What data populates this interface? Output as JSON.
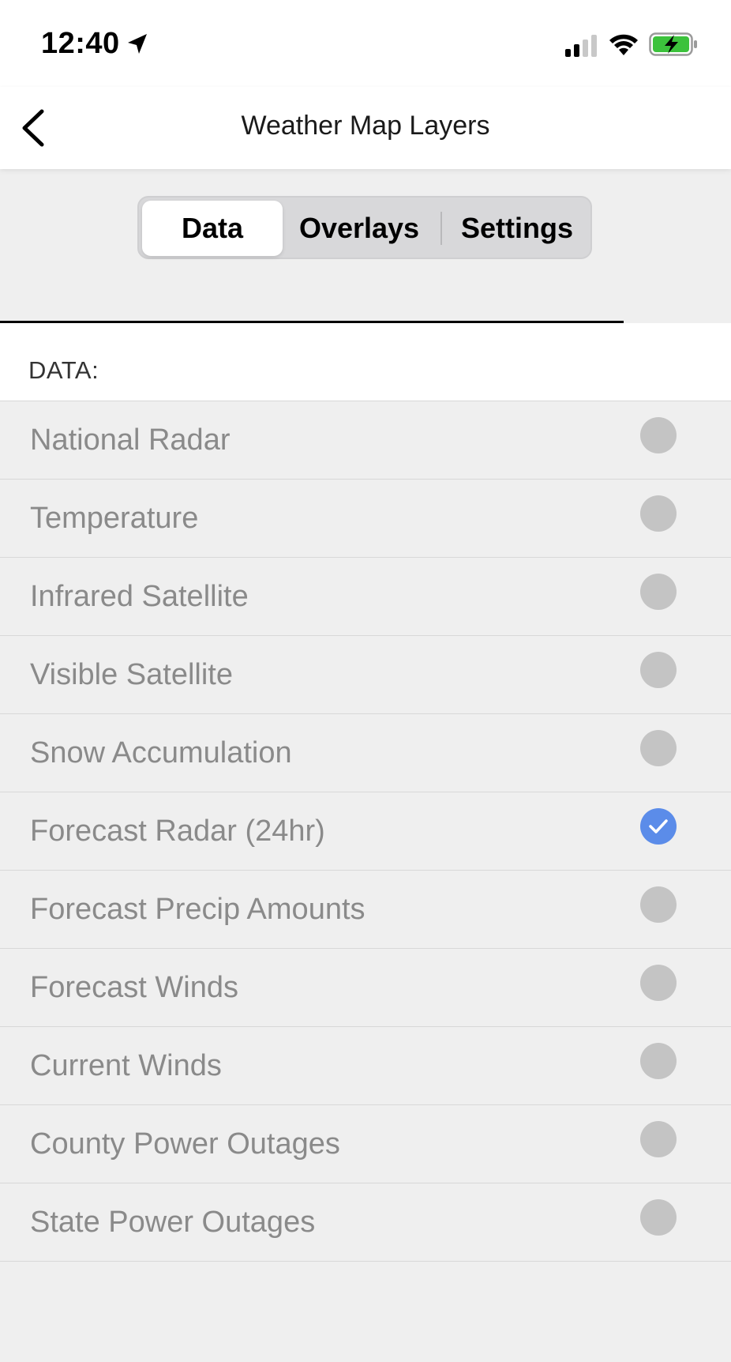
{
  "status_bar": {
    "time": "12:40",
    "icons": [
      "location-arrow-icon",
      "cellular-signal-icon",
      "wifi-icon",
      "battery-charging-icon"
    ],
    "battery_color": "#3cc23c"
  },
  "nav": {
    "title": "Weather Map Layers",
    "back_icon": "chevron-left-icon"
  },
  "segments": {
    "items": [
      {
        "label": "Data",
        "selected": true
      },
      {
        "label": "Overlays",
        "selected": false
      },
      {
        "label": "Settings",
        "selected": false
      }
    ]
  },
  "section": {
    "label": "DATA:"
  },
  "layers": [
    {
      "label": "National Radar",
      "selected": false
    },
    {
      "label": "Temperature",
      "selected": false
    },
    {
      "label": "Infrared Satellite",
      "selected": false
    },
    {
      "label": "Visible Satellite",
      "selected": false
    },
    {
      "label": "Snow Accumulation",
      "selected": false
    },
    {
      "label": "Forecast Radar (24hr)",
      "selected": true
    },
    {
      "label": "Forecast Precip Amounts",
      "selected": false
    },
    {
      "label": "Forecast Winds",
      "selected": false
    },
    {
      "label": "Current Winds",
      "selected": false
    },
    {
      "label": "County Power Outages",
      "selected": false
    },
    {
      "label": "State Power Outages",
      "selected": false
    }
  ],
  "colors": {
    "accent": "#5b8ce9",
    "radio_unselected": "#c4c4c4",
    "background": "#efefef"
  }
}
